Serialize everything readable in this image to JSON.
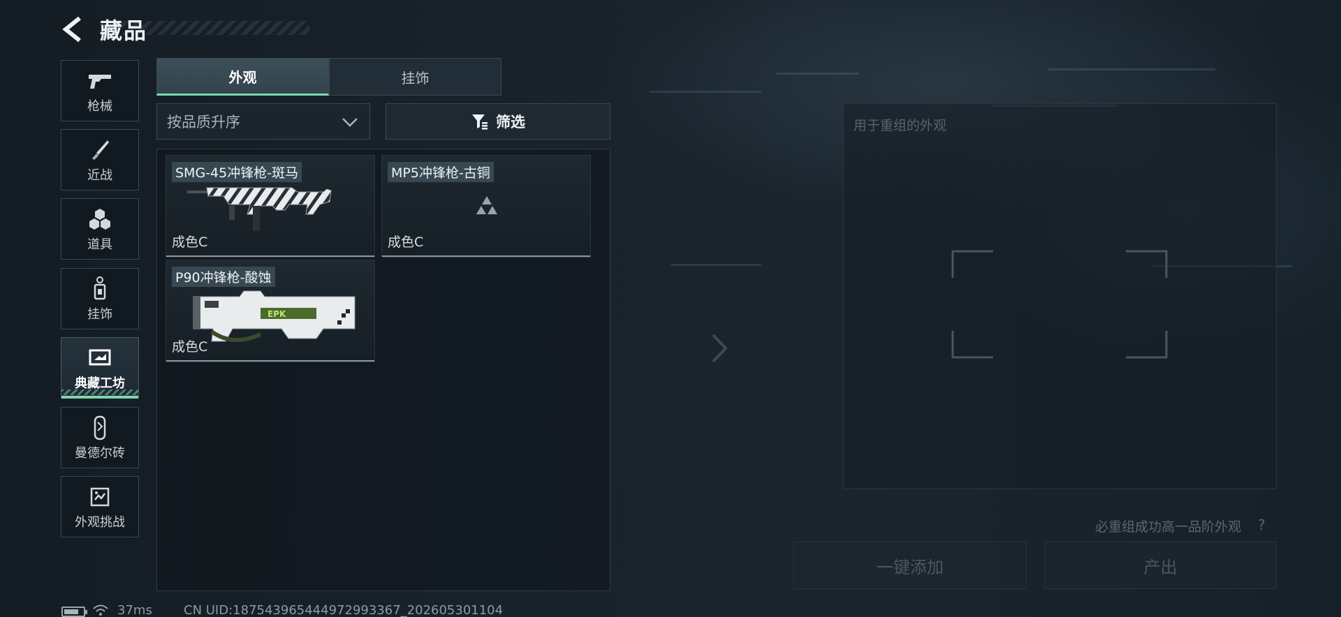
{
  "header": {
    "title": "藏品"
  },
  "sidebar": {
    "items": [
      {
        "label": "枪械",
        "icon": "gun-icon"
      },
      {
        "label": "近战",
        "icon": "knife-icon"
      },
      {
        "label": "道具",
        "icon": "grenade-icon"
      },
      {
        "label": "挂饰",
        "icon": "charm-icon"
      },
      {
        "label": "典藏工坊",
        "icon": "workshop-icon",
        "active": true
      },
      {
        "label": "曼德尔砖",
        "icon": "brick-icon"
      },
      {
        "label": "外观挑战",
        "icon": "challenge-icon"
      }
    ]
  },
  "tabs": [
    {
      "label": "外观",
      "active": true
    },
    {
      "label": "挂饰",
      "active": false
    }
  ],
  "controls": {
    "sort_value": "按品质升序",
    "filter_label": "筛选"
  },
  "main": {
    "items": [
      {
        "name": "SMG-45冲锋枪-斑马",
        "grade": "成色C",
        "icon": "smg45-zebra-skin"
      },
      {
        "name": "MP5冲锋枪-古铜",
        "grade": "成色C",
        "icon": "placeholder-triangle-icon"
      },
      {
        "name": "P90冲锋枪-酸蚀",
        "grade": "成色C",
        "icon": "p90-acid-skin"
      }
    ]
  },
  "right_panel": {
    "hint": "用于重组的外观",
    "merge_note": "必重组成功高一品阶外观",
    "help": "?",
    "add_all_label": "一键添加",
    "output_label": "产出"
  },
  "footer": {
    "ping": "37ms",
    "uid": "CN UID:18754396544497299336​7_202605301104"
  },
  "colors": {
    "accent": "#7fd6b0",
    "background": "#18222b",
    "panel_border": "#3a464f"
  }
}
